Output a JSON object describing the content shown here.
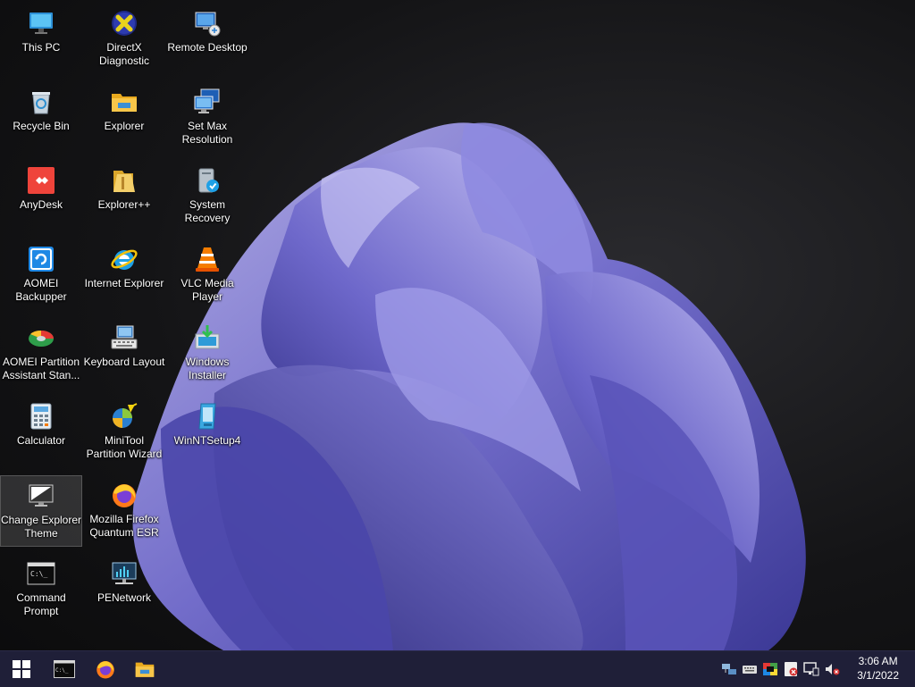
{
  "desktop": {
    "icons": [
      {
        "label": "This PC",
        "icon": "monitor-icon"
      },
      {
        "label": "Recycle Bin",
        "icon": "recycle-bin-icon"
      },
      {
        "label": "AnyDesk",
        "icon": "anydesk-icon"
      },
      {
        "label": "AOMEI\nBackupper",
        "icon": "aomei-backupper-icon"
      },
      {
        "label": "AOMEI Partition\nAssistant Stan...",
        "icon": "aomei-partition-icon"
      },
      {
        "label": "Calculator",
        "icon": "calculator-icon"
      },
      {
        "label": "Change Explorer\nTheme",
        "icon": "theme-monitor-icon"
      },
      {
        "label": "Command\nPrompt",
        "icon": "command-prompt-icon"
      },
      {
        "label": "DirectX\nDiagnostic",
        "icon": "directx-icon"
      },
      {
        "label": "Explorer",
        "icon": "folder-icon"
      },
      {
        "label": "Explorer++",
        "icon": "explorerpp-icon"
      },
      {
        "label": "Internet Explorer",
        "icon": "internet-explorer-icon"
      },
      {
        "label": "Keyboard Layout",
        "icon": "keyboard-icon"
      },
      {
        "label": "MiniTool\nPartition Wizard",
        "icon": "minitool-icon"
      },
      {
        "label": "Mozilla Firefox\nQuantum ESR",
        "icon": "firefox-icon"
      },
      {
        "label": "PENetwork",
        "icon": "network-icon"
      },
      {
        "label": "Remote Desktop",
        "icon": "remote-desktop-icon"
      },
      {
        "label": "Set Max\nResolution",
        "icon": "display-settings-icon"
      },
      {
        "label": "System Recovery",
        "icon": "system-recovery-icon"
      },
      {
        "label": "VLC Media\nPlayer",
        "icon": "vlc-icon"
      },
      {
        "label": "Windows\nInstaller",
        "icon": "windows-installer-icon"
      },
      {
        "label": "WinNTSetup4",
        "icon": "winntsetup-icon"
      }
    ],
    "selected": "Change Explorer\nTheme"
  },
  "taskbar": {
    "pinned": [
      "windows-start-icon",
      "command-prompt-icon",
      "firefox-icon",
      "folder-icon"
    ],
    "tray": [
      "network-adapter-icon",
      "keyboard-icon",
      "color-picker-icon",
      "defender-icon",
      "display-icon",
      "network-icon",
      "volume-muted-icon"
    ],
    "time": "3:06 AM",
    "date": "3/1/2022"
  },
  "colors": {
    "taskbar": "#1f1f38",
    "bloom": "#6a66c8",
    "bloom_light": "#a9a4ea"
  }
}
